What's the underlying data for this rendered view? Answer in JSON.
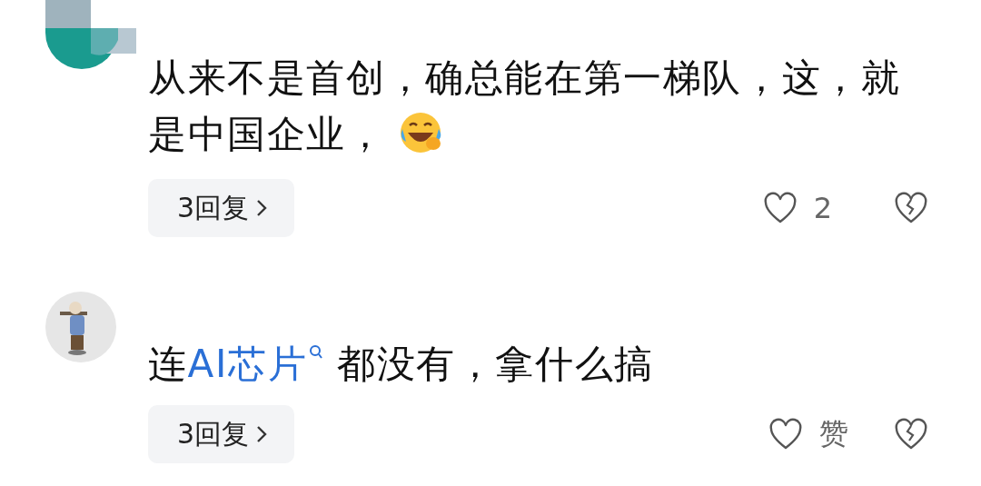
{
  "comments": [
    {
      "avatar": {
        "kind": "picture"
      },
      "content": [
        {
          "kind": "text",
          "text": "从来不是首创，确总能在第一梯队，这，就是中国企业，"
        },
        {
          "kind": "emoji"
        }
      ],
      "replies": "3回复",
      "like_label": "2"
    },
    {
      "avatar": {
        "kind": "picture"
      },
      "content": [
        {
          "kind": "text",
          "text": "连"
        },
        {
          "kind": "link",
          "text": "AI芯片"
        },
        {
          "kind": "text",
          "text": " 都没有，拿什么搞"
        }
      ],
      "replies": "3回复",
      "like_label": "赞"
    }
  ]
}
